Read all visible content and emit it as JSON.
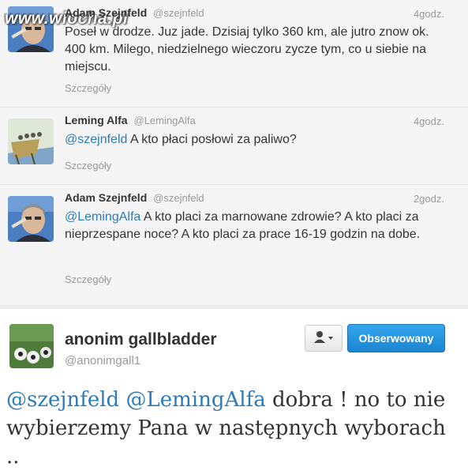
{
  "watermark": "www.wiocha.pl",
  "tweets": [
    {
      "name": "Adam Szejnfeld",
      "handle": "@szejnfeld",
      "time": "4godz.",
      "text": "Poseł w drodze. Juz jade. Dzisiaj tylko 360 km, ale jutro znow ok. 400 km. Milego, niedzielnego wieczoru zycze tym, co u siebie na miejscu.",
      "details": "Szczegóły"
    },
    {
      "name": "Leming Alfa",
      "handle": "@LemingAlfa",
      "time": "4godz.",
      "mention": "@szejnfeld",
      "text": " A kto płaci posłowi za paliwo?",
      "details": "Szczegóły"
    },
    {
      "name": "Adam Szejnfeld",
      "handle": "@szejnfeld",
      "time": "2godz.",
      "mention": "@LemingAlfa",
      "text": " A kto placi za marnowane zdrowie? A kto placi za nieprzespane noce? A kto placi za prace 16-19 godzin na dobe.",
      "details": "Szczegóły"
    }
  ],
  "profile": {
    "name": "anonim gallbladder",
    "handle": "@anonimgall1",
    "follow_label": "Obserwowany",
    "user_menu_icon": "person-dropdown-icon"
  },
  "reply": {
    "mention1": "@szejnfeld",
    "mention2": "@LemingAlfa",
    "text": " dobra ! no to nie wybierzemy Pana w następnych wyborach .."
  }
}
